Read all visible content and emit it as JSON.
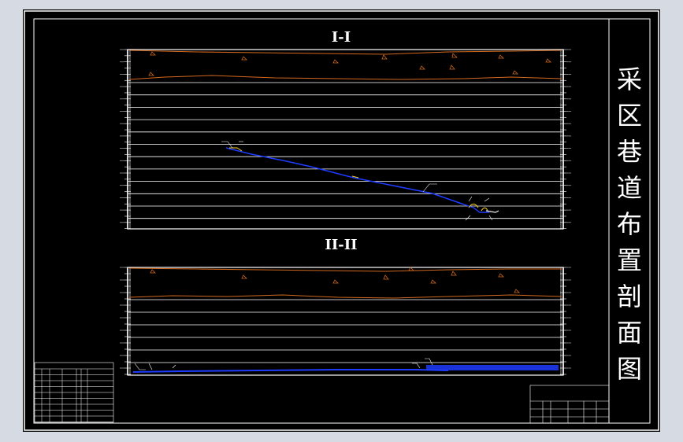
{
  "sheet_title": {
    "chars": [
      "采",
      "区",
      "巷",
      "道",
      "布",
      "置",
      "剖",
      "面",
      "图"
    ]
  },
  "sections": [
    {
      "label": "I-I"
    },
    {
      "label": "II-II"
    }
  ],
  "colors": {
    "background": "#000000",
    "frame": "#ffffff",
    "terrain": "#d2691e",
    "roadway": "#1e3cff",
    "highlight": "#ffd21e",
    "window_bg": "#d5dae3"
  }
}
